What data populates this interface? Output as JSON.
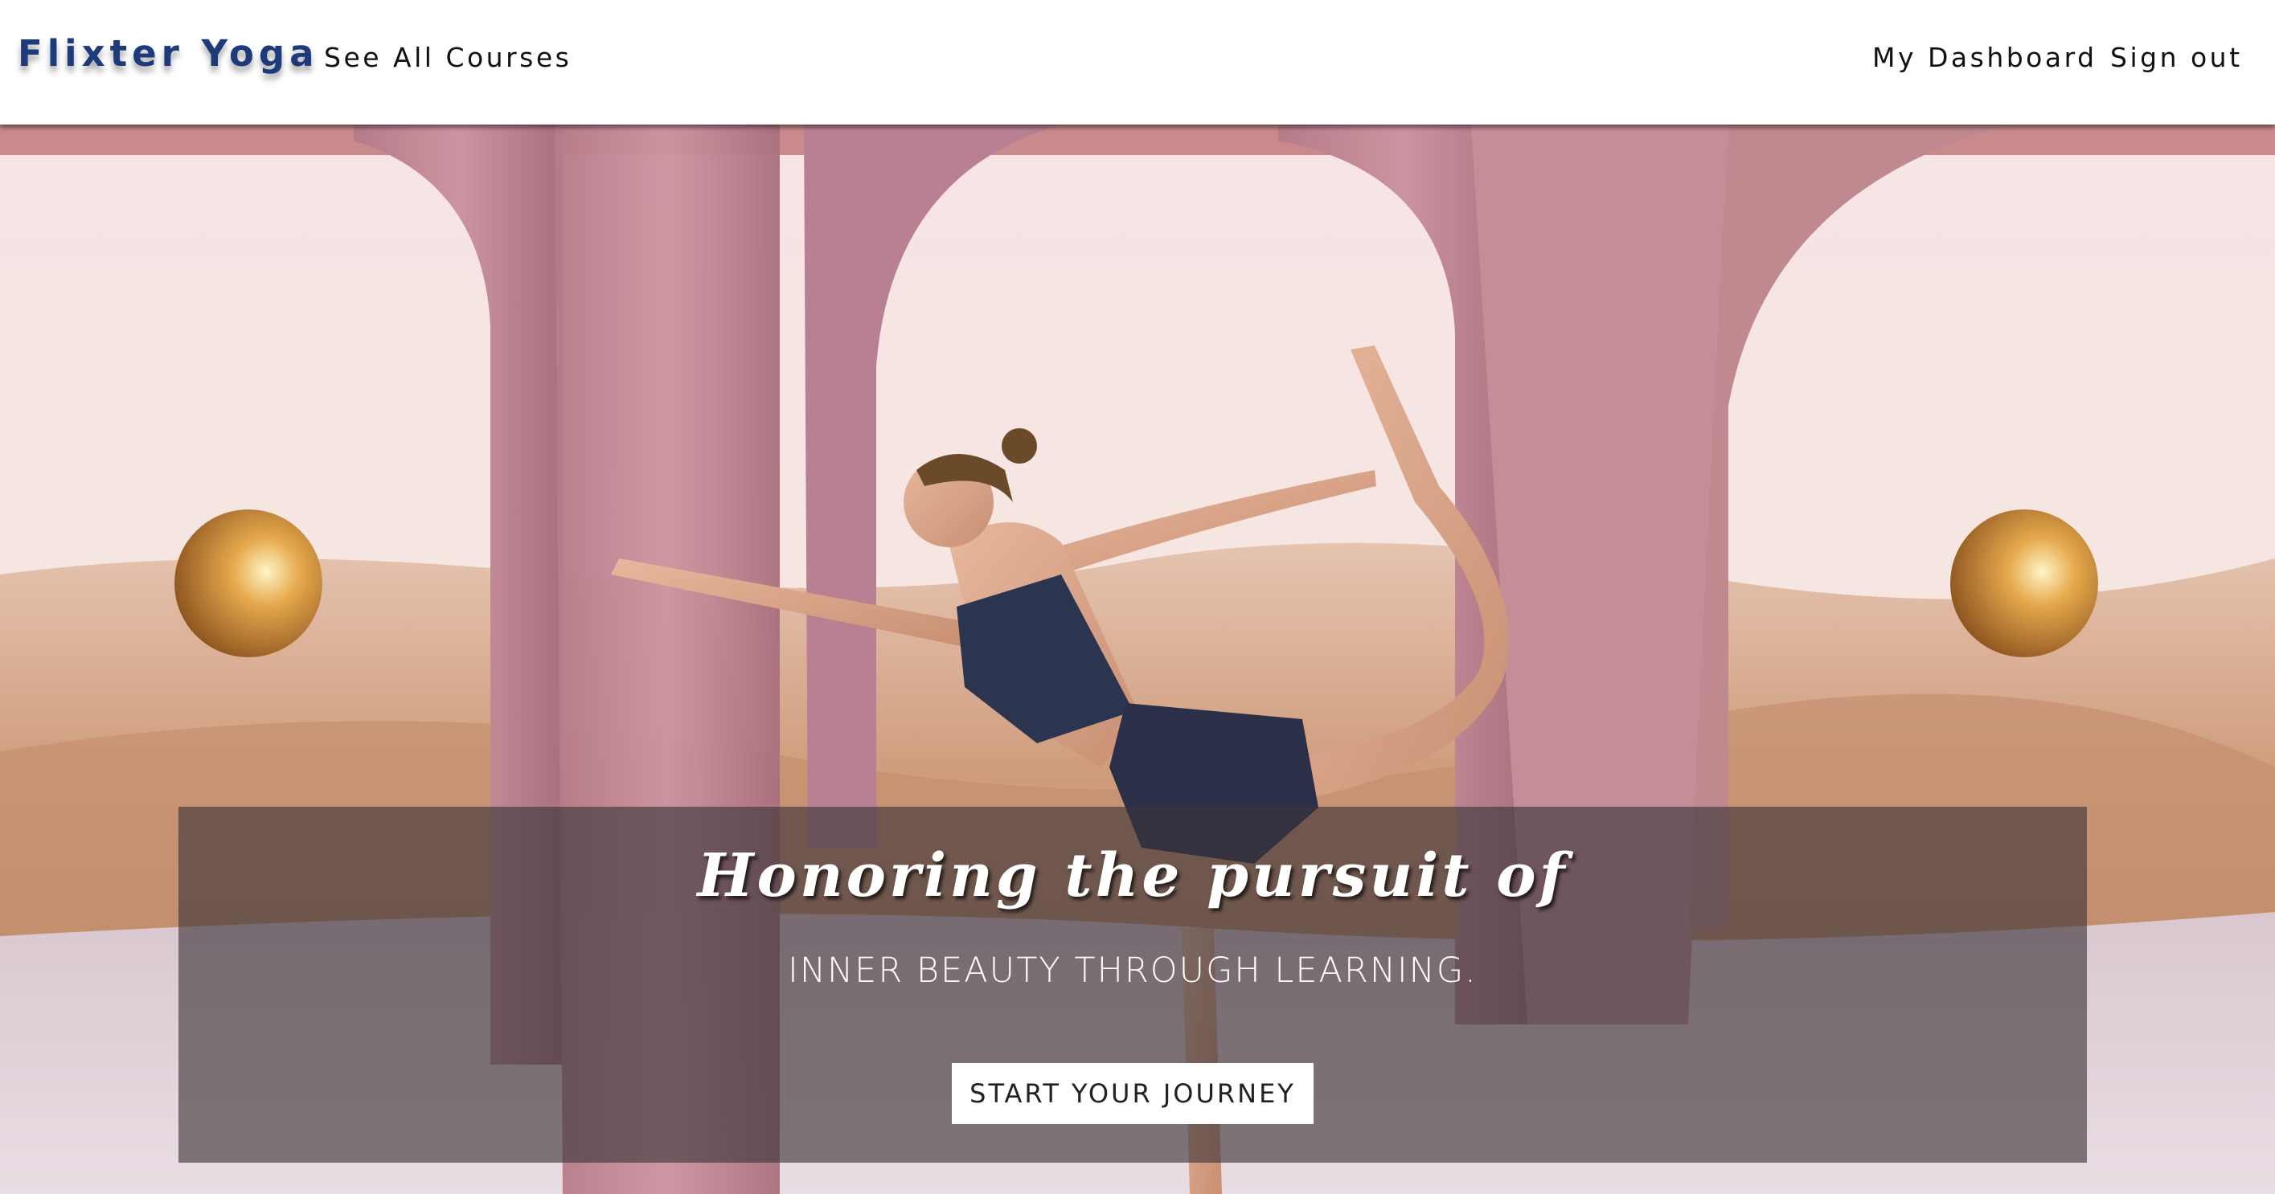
{
  "navbar": {
    "brand": "Flixter Yoga",
    "courses_link": "See All Courses",
    "dashboard_link": "My Dashboard",
    "signout_link": "Sign out"
  },
  "hero": {
    "title": "Honoring the pursuit of",
    "subtitle": "INNER BEAUTY THROUGH LEARNING.",
    "cta_label": "START YOUR JOURNEY"
  },
  "colors": {
    "brand": "#1d3a7a",
    "overlay": "rgba(58,52,56,0.62)",
    "arch": "#c98f9a",
    "sphere": "#d99a3c"
  }
}
